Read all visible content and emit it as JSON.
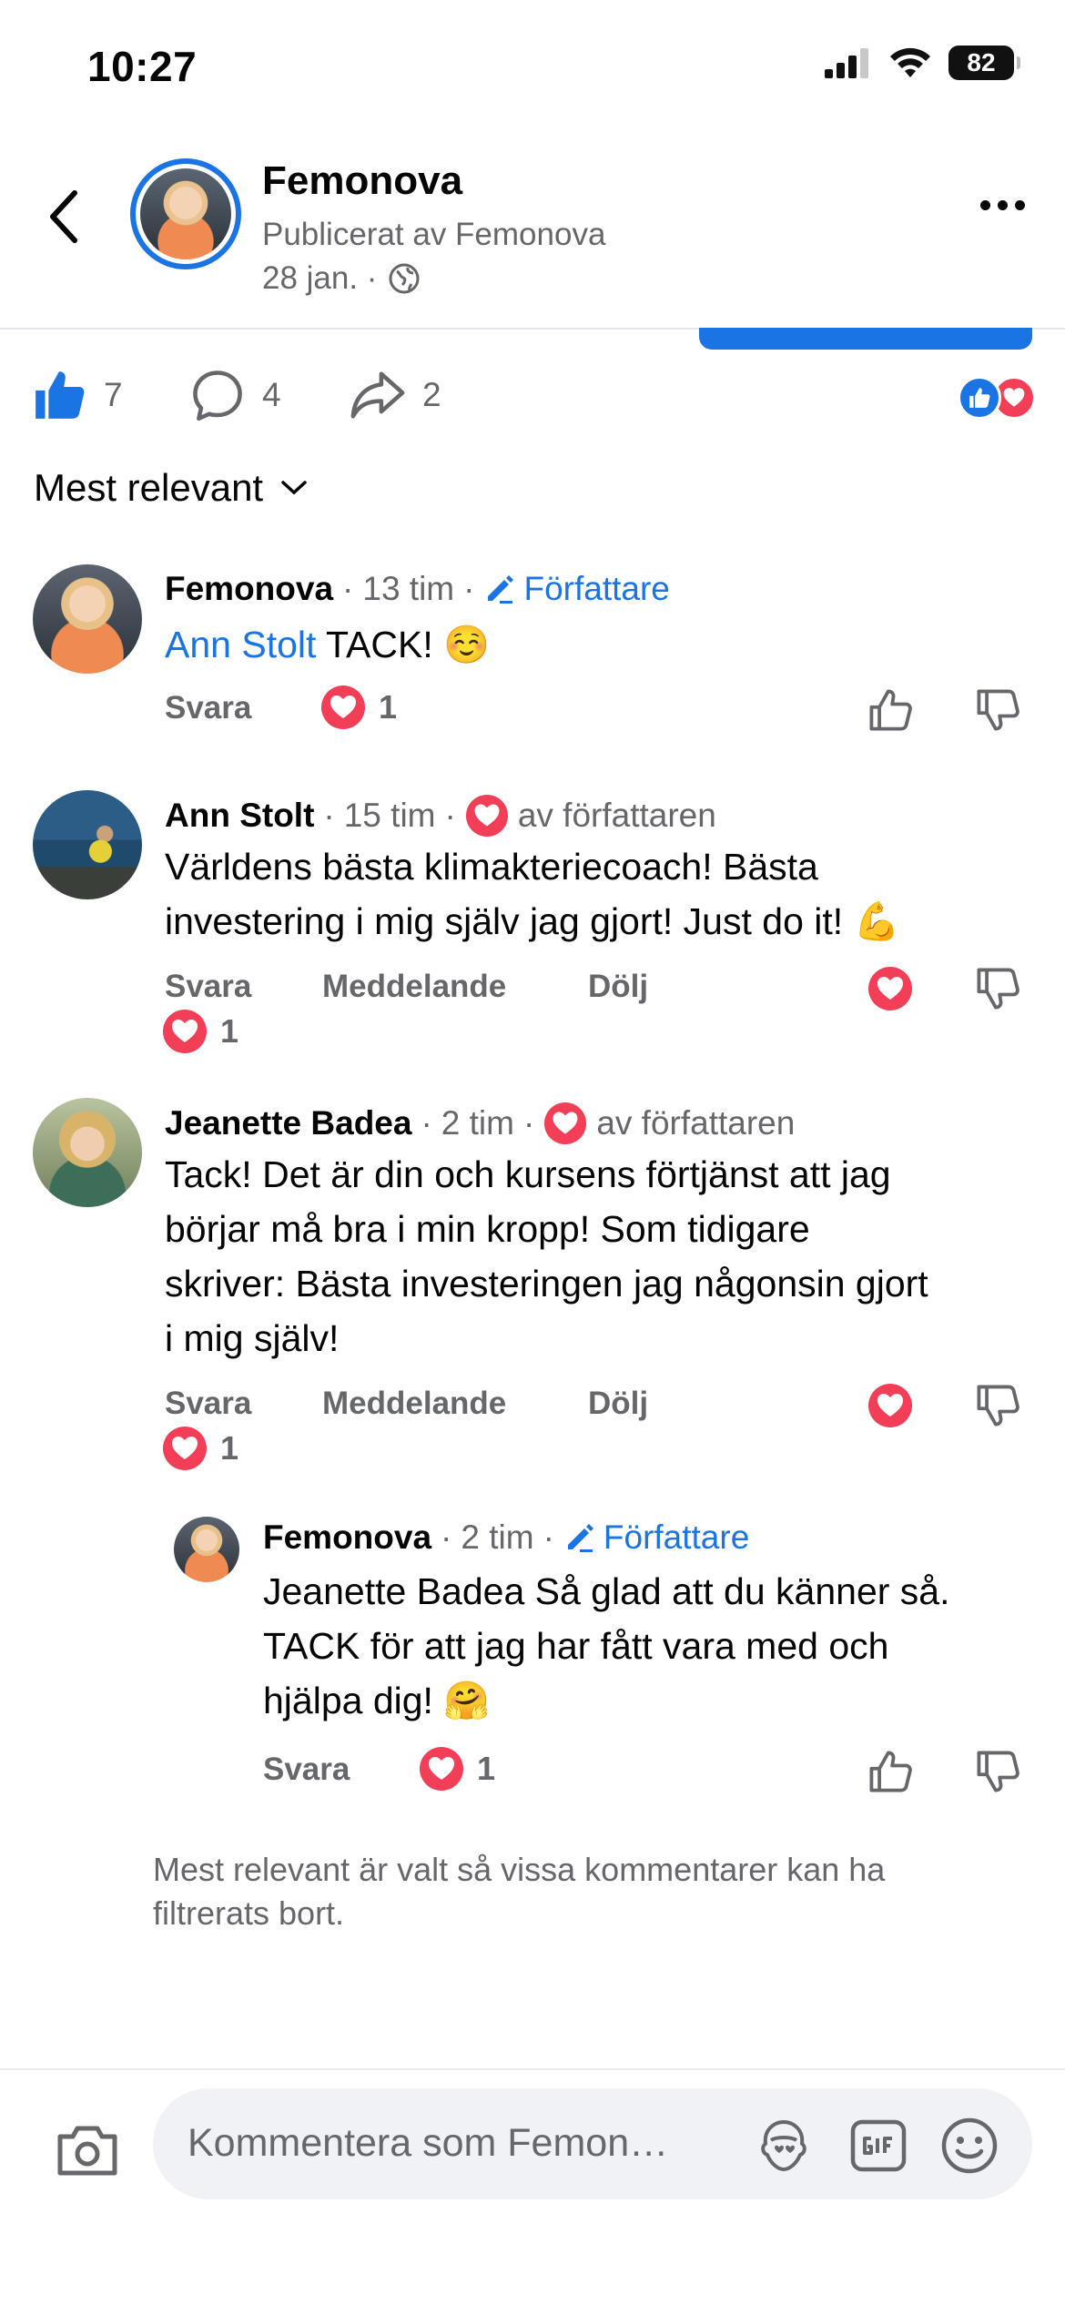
{
  "status_bar": {
    "time": "10:27",
    "battery": "82"
  },
  "header": {
    "page_name": "Femonova",
    "published_by": "Publicerat av Femonova",
    "date": "28 jan. ·"
  },
  "engagement": {
    "likes": "7",
    "comments": "4",
    "shares": "2"
  },
  "sort": {
    "label": "Mest relevant"
  },
  "comments": [
    {
      "name": "Femonova",
      "time": "13 tim",
      "badge": "Författare",
      "mention": "Ann Stolt",
      "text": " TACK! ☺️",
      "reply": "Svara",
      "heart_count": "1"
    },
    {
      "name": "Ann Stolt",
      "time": "15 tim",
      "badge": "av författaren",
      "text_line1": "Världens bästa klimakteriecoach! Bästa",
      "text_line2": "investering i mig själv jag gjort! Just do it! 💪",
      "reply": "Svara",
      "message": "Meddelande",
      "hide": "Dölj",
      "heart_count": "1"
    },
    {
      "name": "Jeanette Badea",
      "time": "2 tim",
      "badge": "av författaren",
      "text_line1": "Tack! Det är din och kursens förtjänst att jag",
      "text_line2": "börjar må bra i min kropp! Som tidigare",
      "text_line3": "skriver: Bästa investeringen jag någonsin gjort",
      "text_line4": "i mig själv!",
      "reply": "Svara",
      "message": "Meddelande",
      "hide": "Dölj",
      "heart_count": "1"
    },
    {
      "name": "Femonova",
      "time": "2 tim",
      "badge": "Författare",
      "text_line1": "Jeanette Badea Så glad att du känner så.",
      "text_line2": "TACK för att jag har fått vara med och",
      "text_line3": "hjälpa dig! 🤗",
      "reply": "Svara",
      "heart_count": "1"
    }
  ],
  "filter_note": "Mest relevant är valt så vissa kommentarer kan ha filtrerats bort.",
  "composer": {
    "placeholder": "Kommentera som Femon…"
  },
  "colors": {
    "accent": "#1b74e4",
    "heart": "#f33e58",
    "secondary_text": "#65676b"
  }
}
